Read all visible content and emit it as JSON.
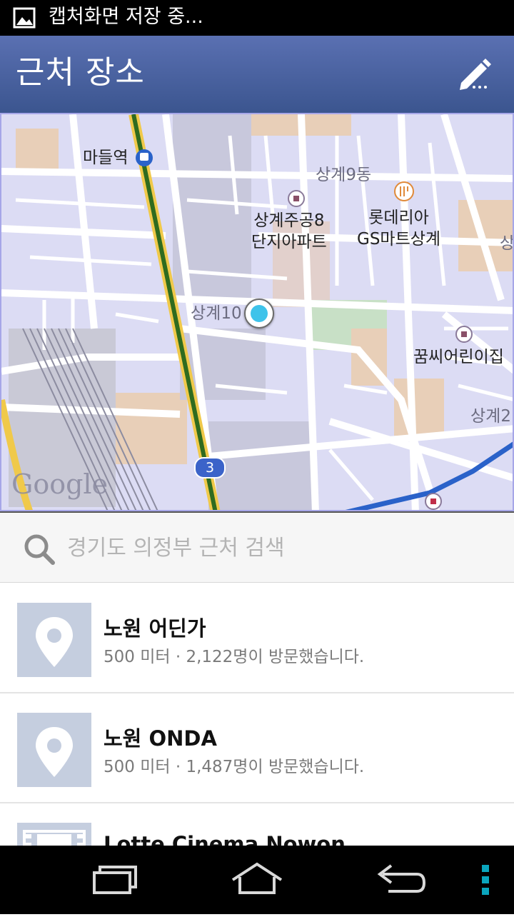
{
  "status_bar": {
    "notification_icon": "image-icon",
    "text": "캡처화면 저장 중..."
  },
  "app_bar": {
    "title": "근처 장소",
    "edit_icon": "pencil-icon"
  },
  "map": {
    "station_label": "마들역",
    "labels": {
      "dong9": "상계9동",
      "apt_line1": "상계주공8",
      "apt_line2": "단지아파트",
      "mart_line1": "롯데리아",
      "mart_line2": "GS마트상계",
      "dong10": "상계10",
      "house": "꿈씨어린이집",
      "dong2": "상계2",
      "edge": "상"
    },
    "route_shield": "3",
    "google_logo": "Google",
    "location_marker": "current-location-marker"
  },
  "search": {
    "placeholder": "경기도 의정부 근처 검색",
    "value": ""
  },
  "places": [
    {
      "name": "노원 어딘가",
      "detail": "500 미터 · 2,122명이 방문했습니다.",
      "icon": "map-pin-icon"
    },
    {
      "name": "노원 ONDA",
      "detail": "500 미터 · 1,487명이 방문했습니다.",
      "icon": "map-pin-icon"
    },
    {
      "name": "Lotte Cinema Nowon",
      "icon": "film-icon"
    }
  ],
  "nav_bar": {
    "recent_icon": "recent-apps-icon",
    "home_icon": "home-icon",
    "back_icon": "back-icon",
    "menu_icon": "overflow-menu-icon"
  },
  "colors": {
    "app_bar": "#4a629f",
    "map_bg": "#dcdcf4",
    "route": "#2a62c9",
    "accent_menu": "#0aa5bd"
  }
}
